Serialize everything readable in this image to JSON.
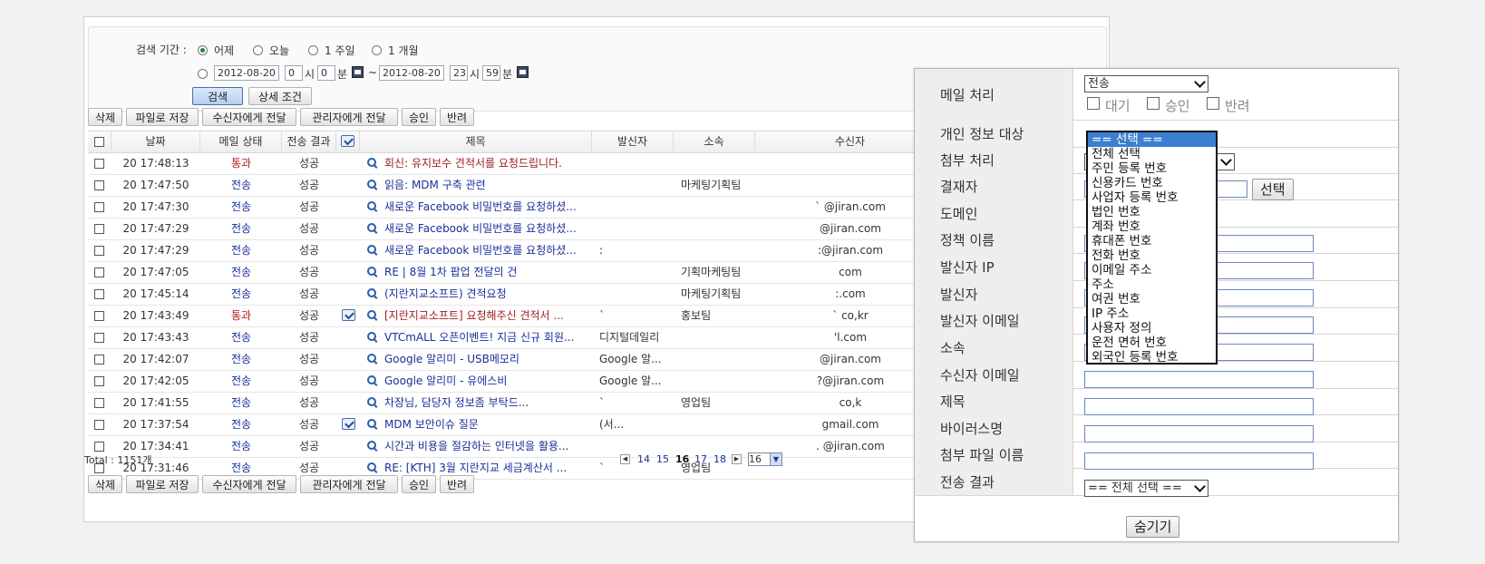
{
  "search": {
    "period_label": "검색 기간 :",
    "period_options": [
      "어제",
      "오늘",
      "1 주일",
      "1 개월"
    ],
    "date_from": "2012-08-20",
    "hour_from": "0",
    "minute_from": "0",
    "date_to": "2012-08-20",
    "hour_to": "23",
    "minute_to": "59",
    "hour_unit": "시",
    "minute_unit": "분",
    "tilde": "~",
    "search_button": "검색",
    "detail_button": "상세 조건"
  },
  "actions": [
    "삭제",
    "파일로 저장",
    "수신자에게 전달",
    "관리자에게 전달",
    "승인",
    "반려"
  ],
  "table": {
    "headers": {
      "date": "날짜",
      "state": "메일 상태",
      "result": "전송 결과",
      "subject": "제목",
      "sender": "발신자",
      "dept": "소속",
      "recipient": "수신자"
    },
    "rows": [
      {
        "date": "20 17:48:13",
        "state": "통과",
        "result": "성공",
        "sign": false,
        "subject": "회신: 유지보수 견적서를 요청드립니다.",
        "sender": "",
        "dept": "",
        "recipient": ""
      },
      {
        "date": "20 17:47:50",
        "state": "전송",
        "result": "성공",
        "sign": false,
        "subject": "읽음: MDM 구축 관련",
        "sender": "",
        "dept": "마케팅기획팀",
        "recipient": ""
      },
      {
        "date": "20 17:47:30",
        "state": "전송",
        "result": "성공",
        "sign": false,
        "subject": "새로운 Facebook 비밀번호를 요청하셨...",
        "sender": "",
        "dept": "",
        "recipient": "` @jiran.com"
      },
      {
        "date": "20 17:47:29",
        "state": "전송",
        "result": "성공",
        "sign": false,
        "subject": "새로운 Facebook 비밀번호를 요청하셨...",
        "sender": "",
        "dept": "",
        "recipient": "@jiran.com"
      },
      {
        "date": "20 17:47:29",
        "state": "전송",
        "result": "성공",
        "sign": false,
        "subject": "새로운 Facebook 비밀번호를 요청하셨...",
        "sender": ":",
        "dept": "",
        "recipient": ":@jiran.com"
      },
      {
        "date": "20 17:47:05",
        "state": "전송",
        "result": "성공",
        "sign": false,
        "subject": "RE            | 8월 1차 팝업 전달의 건",
        "sender": "",
        "dept": "기획마케팅팀",
        "recipient": "com"
      },
      {
        "date": "20 17:45:14",
        "state": "전송",
        "result": "성공",
        "sign": false,
        "subject": "(지란지교소프트) 견적요청",
        "sender": "",
        "dept": "마케팅기획팀",
        "recipient": ":.com"
      },
      {
        "date": "20 17:43:49",
        "state": "통과",
        "result": "성공",
        "sign": true,
        "subject": "[지란지교소프트] 요청해주신 견적서 ...",
        "sender": "`",
        "dept": "홍보팀",
        "recipient": "`  co,kr"
      },
      {
        "date": "20 17:43:43",
        "state": "전송",
        "result": "성공",
        "sign": false,
        "subject": "VTCmALL 오픈이벤트! 지금 신규 회원...",
        "sender": "디지털데일리",
        "dept": "",
        "recipient": "'l.com"
      },
      {
        "date": "20 17:42:07",
        "state": "전송",
        "result": "성공",
        "sign": false,
        "subject": "Google 알리미 - USB메모리",
        "sender": "Google 알...",
        "dept": "",
        "recipient": "@jiran.com"
      },
      {
        "date": "20 17:42:05",
        "state": "전송",
        "result": "성공",
        "sign": false,
        "subject": "Google 알리미 - 유에스비",
        "sender": "Google 알...",
        "dept": "",
        "recipient": "?@jiran.com"
      },
      {
        "date": "20 17:41:55",
        "state": "전송",
        "result": "성공",
        "sign": false,
        "subject": "차장님,            담당자 정보좀 부탁드...",
        "sender": "`",
        "dept": "영업팀",
        "recipient": "co,k"
      },
      {
        "date": "20 17:37:54",
        "state": "전송",
        "result": "성공",
        "sign": true,
        "subject": "MDM 보안이슈 질문",
        "sender": "(서...",
        "dept": "",
        "recipient": "gmail.com"
      },
      {
        "date": "20 17:34:41",
        "state": "전송",
        "result": "성공",
        "sign": false,
        "subject": "시간과 비용을 절감하는 인터넷을 활용...",
        "sender": "",
        "dept": "",
        "recipient": ".    @jiran.com"
      },
      {
        "date": "20 17:31:46",
        "state": "전송",
        "result": "성공",
        "sign": false,
        "subject": "RE: [KTH] 3월 지란지교 세금계산서 ...",
        "sender": "`",
        "dept": "영업팀",
        "recipient": ""
      }
    ],
    "total": "Total : 1151개"
  },
  "pager": {
    "pages": [
      "14",
      "15",
      "16",
      "17",
      "18"
    ],
    "current": "16",
    "select_value": "16",
    "prev_icon": "prev-page-icon",
    "next_icon": "next-page-icon"
  },
  "panel": {
    "rows": [
      {
        "label": "메일 처리"
      },
      {
        "label": "개인 정보 대상"
      },
      {
        "label": "첨부 처리"
      },
      {
        "label": "결재자"
      },
      {
        "label": "도메인"
      },
      {
        "label": "정책 이름"
      },
      {
        "label": "발신자 IP"
      },
      {
        "label": "발신자"
      },
      {
        "label": "발신자 이메일"
      },
      {
        "label": "소속"
      },
      {
        "label": "수신자 이메일"
      },
      {
        "label": "제목"
      },
      {
        "label": "바이러스명"
      },
      {
        "label": "첨부 파일 이름"
      },
      {
        "label": "전송 결과"
      }
    ],
    "mail_process_select": "전송",
    "mail_process_checks": [
      "대기",
      "승인",
      "반려"
    ],
    "approver_button": "선택",
    "result_select": "== 전체 선택 ==",
    "hide_button": "숨기기",
    "privacy_dropdown": {
      "selected": "== 선택 ==",
      "options": [
        "== 선택 ==",
        "전체 선택",
        "주민 등록 번호",
        "신용카드 번호",
        "사업자 등록 번호",
        "법인 번호",
        "계좌 번호",
        "휴대폰 번호",
        "전화 번호",
        "이메일 주소",
        "주소",
        "여권 번호",
        "IP 주소",
        "사용자 정의",
        "운전 면허 번호",
        "외국인 등록 번호"
      ]
    }
  },
  "colors": {
    "state_pass": "#b01c1c",
    "state_send": "#1a2f9a",
    "dropdown_highlight": "#3c7fd0"
  }
}
